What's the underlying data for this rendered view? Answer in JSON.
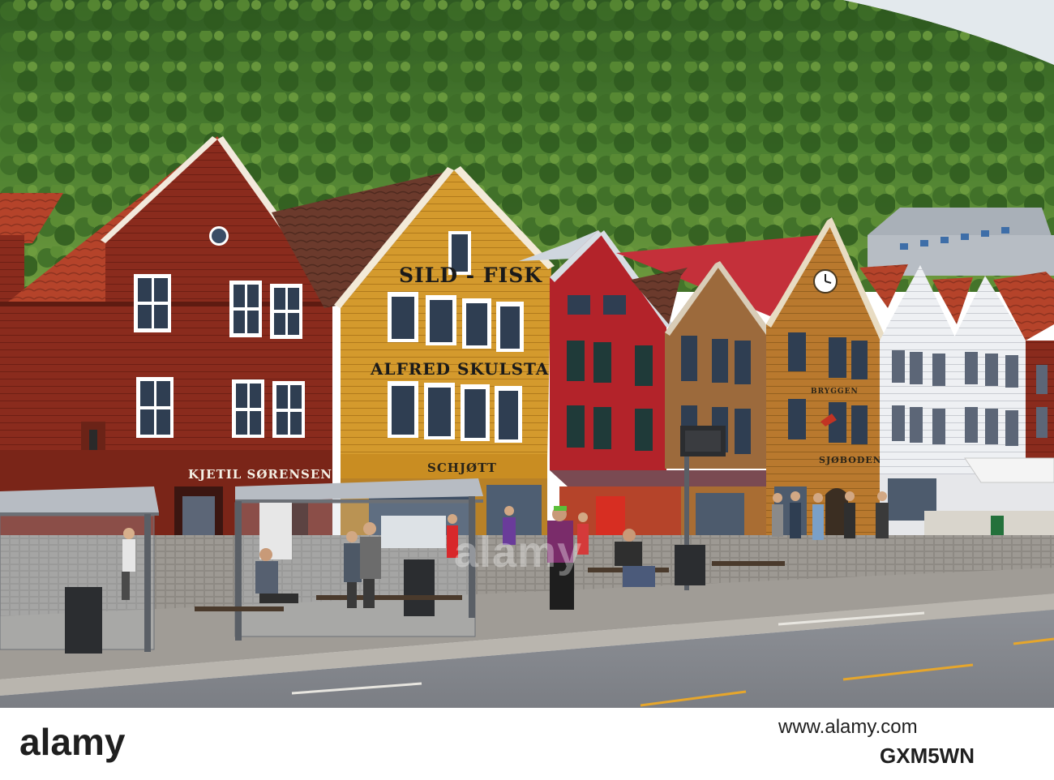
{
  "signs": {
    "kjetil": "KJETIL SØRENSEN",
    "sild_fisk": "SILD - FISK",
    "alfred": "ALFRED SKULSTAD",
    "schjott": "SCHJØTT",
    "bryggen": "BRYGGEN",
    "sjoboden": "SJØBODEN"
  },
  "watermark": {
    "brand": "alamy",
    "overlay": "alamy",
    "image_id": "GXM5WN",
    "url": "www.alamy.com"
  },
  "colors": {
    "red_house": "#8a2b1d",
    "ochre_house": "#d49a2d",
    "crimson_house": "#b3232a",
    "brown_house": "#9c6a3c",
    "white_house": "#f1f2f4",
    "forest": "#3c6b2a"
  }
}
